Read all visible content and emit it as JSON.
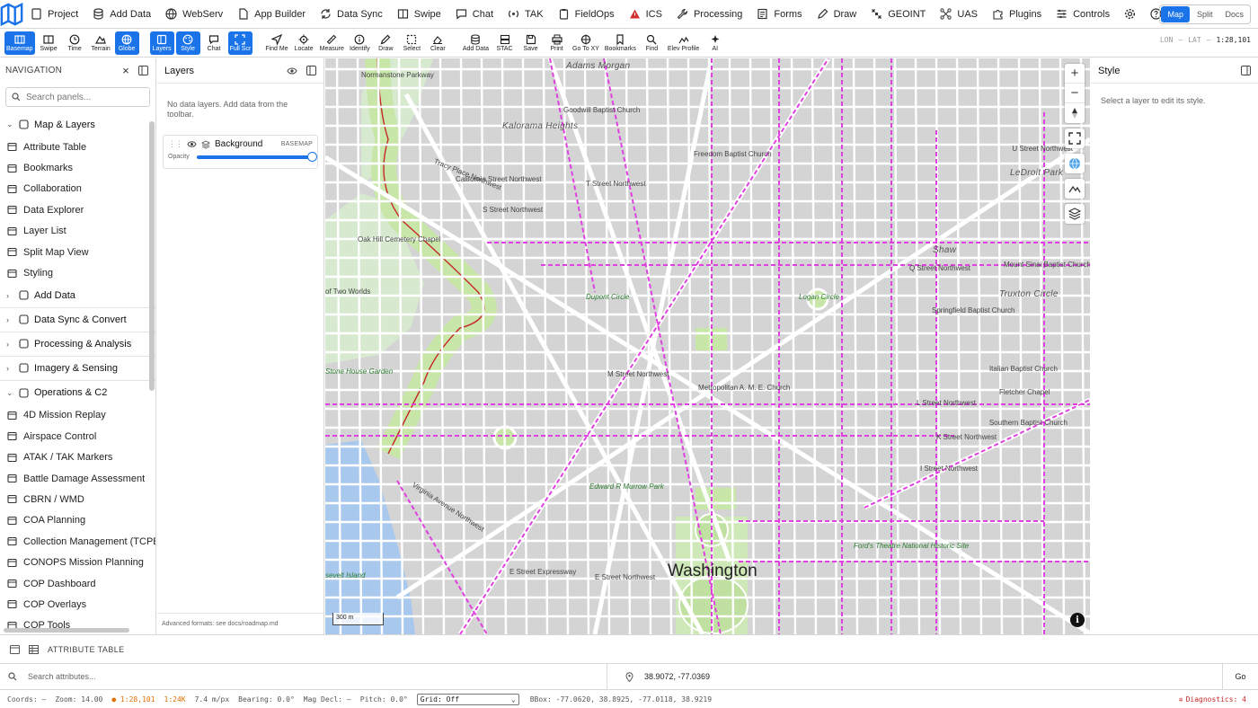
{
  "menubar": {
    "items": [
      {
        "label": "Project",
        "icon": "file-icon"
      },
      {
        "label": "Add Data",
        "icon": "database-icon"
      },
      {
        "label": "WebServ",
        "icon": "globe-icon"
      },
      {
        "label": "App Builder",
        "icon": "document-icon"
      },
      {
        "label": "Data Sync",
        "icon": "sync-icon"
      },
      {
        "label": "Swipe",
        "icon": "columns-icon"
      },
      {
        "label": "Chat",
        "icon": "chat-icon"
      },
      {
        "label": "TAK",
        "icon": "radio-icon"
      },
      {
        "label": "FieldOps",
        "icon": "clipboard-icon"
      },
      {
        "label": "ICS",
        "icon": "alert-icon"
      },
      {
        "label": "Processing",
        "icon": "wrench-icon"
      },
      {
        "label": "Forms",
        "icon": "form-icon"
      },
      {
        "label": "Draw",
        "icon": "pen-icon"
      },
      {
        "label": "GEOINT",
        "icon": "satellite-icon"
      },
      {
        "label": "UAS",
        "icon": "drone-icon"
      },
      {
        "label": "Plugins",
        "icon": "puzzle-icon"
      },
      {
        "label": "Controls",
        "icon": "sliders-icon"
      },
      {
        "label": "",
        "icon": "gear-icon"
      },
      {
        "label": "Help",
        "icon": "help-icon"
      }
    ],
    "modes": [
      "Map",
      "Split",
      "Docs"
    ],
    "active_mode": "Map"
  },
  "toolbar": {
    "tools": [
      {
        "label": "Basemap",
        "active": true
      },
      {
        "label": "Swipe",
        "active": false
      },
      {
        "label": "Time",
        "active": false
      },
      {
        "label": "Terrain",
        "active": false
      },
      {
        "label": "Globe",
        "active": true
      },
      {
        "label": "Layers",
        "active": true
      },
      {
        "label": "Style",
        "active": true
      },
      {
        "label": "Chat",
        "active": false
      },
      {
        "label": "Full Scr",
        "active": true
      },
      {
        "label": "Find Me",
        "active": false
      },
      {
        "label": "Locate",
        "active": false
      },
      {
        "label": "Measure",
        "active": false
      },
      {
        "label": "Identify",
        "active": false
      },
      {
        "label": "Draw",
        "active": false
      },
      {
        "label": "Select",
        "active": false
      },
      {
        "label": "Clear",
        "active": false
      },
      {
        "label": "Add Data",
        "active": false
      },
      {
        "label": "STAC",
        "active": false
      },
      {
        "label": "Save",
        "active": false
      },
      {
        "label": "Print",
        "active": false
      },
      {
        "label": "Go To XY",
        "active": false
      },
      {
        "label": "Bookmarks",
        "active": false
      },
      {
        "label": "Find",
        "active": false
      },
      {
        "label": "Elev Profile",
        "active": false
      },
      {
        "label": "AI",
        "active": false
      }
    ],
    "lon_label": "LON",
    "lon_value": "—",
    "lat_label": "LAT",
    "lat_value": "—",
    "scale_value": "1:28,101"
  },
  "navigation": {
    "title": "NAVIGATION",
    "search_placeholder": "Search panels...",
    "sections": [
      {
        "label": "Map & Layers",
        "open": true,
        "items": [
          "Attribute Table",
          "Bookmarks",
          "Collaboration",
          "Data Explorer",
          "Layer List",
          "Split Map View",
          "Styling"
        ]
      },
      {
        "label": "Add Data",
        "open": false,
        "items": []
      },
      {
        "label": "Data Sync & Convert",
        "open": false,
        "items": []
      },
      {
        "label": "Processing & Analysis",
        "open": false,
        "items": []
      },
      {
        "label": "Imagery & Sensing",
        "open": false,
        "items": []
      },
      {
        "label": "Operations & C2",
        "open": true,
        "items": [
          "4D Mission Replay",
          "Airspace Control",
          "ATAK / TAK Markers",
          "Battle Damage Assessment",
          "CBRN / WMD",
          "COA Planning",
          "Collection Management (TCPED)",
          "CONOPS Mission Planning",
          "COP Dashboard",
          "COP Overlays",
          "COP Tools"
        ]
      }
    ]
  },
  "layers_panel": {
    "title": "Layers",
    "empty_text": "No data layers. Add data from the toolbar.",
    "layer": {
      "name": "Background",
      "badge": "BASEMAP",
      "opacity_label": "Opacity",
      "opacity": 1.0
    },
    "footer": "Advanced formats: see docs/roadmap.md"
  },
  "map": {
    "labels": [
      {
        "text": "Adams Morgan",
        "kind": "hood"
      },
      {
        "text": "Normanstone Parkway",
        "kind": "street"
      },
      {
        "text": "Kalorama Heights",
        "kind": "hood"
      },
      {
        "text": "Goodwill Baptist Church",
        "kind": "street"
      },
      {
        "text": "Freedom Baptist Church",
        "kind": "street"
      },
      {
        "text": "U Street Northwest",
        "kind": "street"
      },
      {
        "text": "LeDroit Park",
        "kind": "hood"
      },
      {
        "text": "California Street Northwest",
        "kind": "street"
      },
      {
        "text": "Tracy Place Northwest",
        "kind": "street"
      },
      {
        "text": "T Street Northwest",
        "kind": "street"
      },
      {
        "text": "S Street Northwest",
        "kind": "street"
      },
      {
        "text": "Oak Hill Cemetery Chapel",
        "kind": "street"
      },
      {
        "text": "Shaw",
        "kind": "hood"
      },
      {
        "text": "Q Street Northwest",
        "kind": "street"
      },
      {
        "text": "Mount Sinai Baptist Church",
        "kind": "street"
      },
      {
        "text": "of Two Worlds",
        "kind": "street"
      },
      {
        "text": "Dupont Circle",
        "kind": "park"
      },
      {
        "text": "Logan Circle",
        "kind": "park"
      },
      {
        "text": "Truxton Circle",
        "kind": "hood"
      },
      {
        "text": "Springfield Baptist Church",
        "kind": "street"
      },
      {
        "text": "Stone House Garden",
        "kind": "park"
      },
      {
        "text": "M Street Northwest",
        "kind": "street"
      },
      {
        "text": "Metropolitan A. M. E. Church",
        "kind": "street"
      },
      {
        "text": "Italian Baptist Church",
        "kind": "street"
      },
      {
        "text": "Fletcher Chapel",
        "kind": "street"
      },
      {
        "text": "L Street Northwest",
        "kind": "street"
      },
      {
        "text": "Southern Baptist Church",
        "kind": "street"
      },
      {
        "text": "K Street Northwest",
        "kind": "street"
      },
      {
        "text": "I Street Northwest",
        "kind": "street"
      },
      {
        "text": "Edward R Murrow Park",
        "kind": "park"
      },
      {
        "text": "Virginia Avenue Northwest",
        "kind": "street"
      },
      {
        "text": "Ford's Theatre National Historic Site",
        "kind": "park"
      },
      {
        "text": "E Street Expressway",
        "kind": "street"
      },
      {
        "text": "E Street Northwest",
        "kind": "street"
      },
      {
        "text": "Washington",
        "kind": "big"
      },
      {
        "text": "sevelt Island",
        "kind": "park"
      }
    ],
    "scale_bar": "300 m"
  },
  "style_panel": {
    "title": "Style",
    "empty_text": "Select a layer to edit its style."
  },
  "attribute_table": {
    "title": "ATTRIBUTE TABLE"
  },
  "search": {
    "placeholder": "Search attributes...",
    "coordinate_value": "38.9072, -77.0369",
    "go_label": "Go"
  },
  "status": {
    "coords": "Coords: —",
    "zoom": "Zoom: 14.00",
    "scale1": "1:28,101",
    "scale2": "1:24K",
    "resolution": "7.4 m/px",
    "bearing": "Bearing: 0.0°",
    "mag_decl": "Mag Decl: —",
    "pitch": "Pitch: 0.0°",
    "grid": "Grid: Off",
    "bbox": "BBox: -77.0620, 38.8925, -77.0118, 38.9219",
    "diagnostics": "Diagnostics: 4"
  },
  "colors": {
    "accent": "#1a73e8",
    "bike_lane": "#e040e0",
    "water": "#a8c8ee",
    "park": "#c8e6a8",
    "diag": "#c62828"
  }
}
